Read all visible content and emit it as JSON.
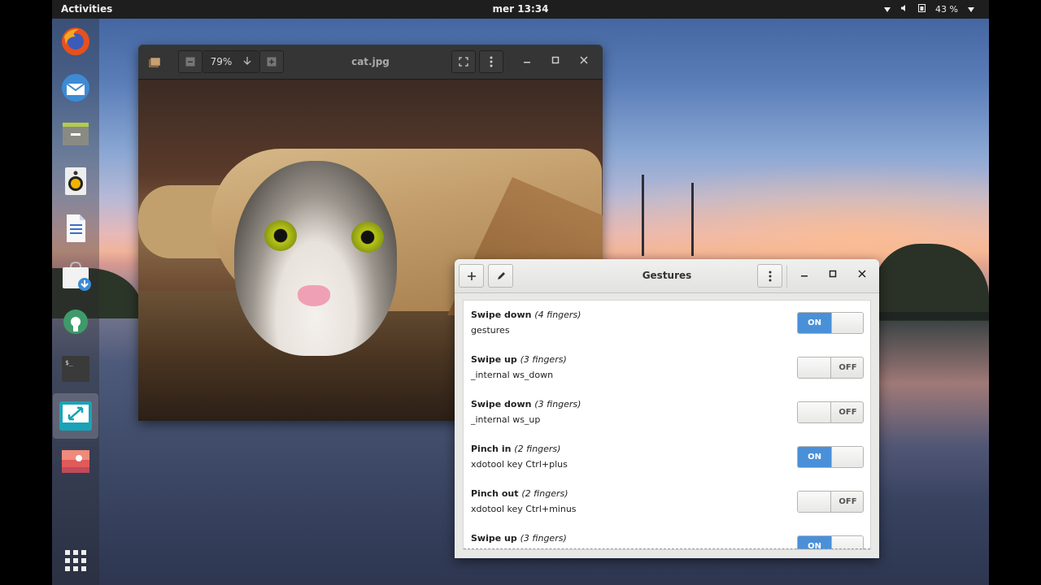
{
  "topbar": {
    "activities_label": "Activities",
    "clock": "mer 13:34",
    "battery_percent": "43 %"
  },
  "dock": {
    "items": [
      "firefox-icon",
      "thunderbird-icon",
      "files-icon",
      "rhythmbox-icon",
      "writer-icon",
      "software-icon",
      "settings-icon",
      "terminal-icon",
      "gestures-app-icon",
      "image-viewer-icon",
      "app-grid-icon"
    ],
    "terminal_glyph": "$_"
  },
  "viewer": {
    "title": "cat.jpg",
    "zoom": "79%",
    "zoom_out_label": "−",
    "zoom_in_label": "+"
  },
  "gestures": {
    "title": "Gestures",
    "add_label": "+",
    "rows": [
      {
        "action": "Swipe down",
        "fingers": "(4 fingers)",
        "command": "gestures",
        "state": "ON"
      },
      {
        "action": "Swipe up",
        "fingers": "(3 fingers)",
        "command": "_internal ws_down",
        "state": "OFF"
      },
      {
        "action": "Swipe down",
        "fingers": "(3 fingers)",
        "command": "_internal ws_up",
        "state": "OFF"
      },
      {
        "action": "Pinch in",
        "fingers": "(2 fingers)",
        "command": "xdotool key Ctrl+plus",
        "state": "ON"
      },
      {
        "action": "Pinch out",
        "fingers": "(2 fingers)",
        "command": "xdotool key Ctrl+minus",
        "state": "OFF"
      },
      {
        "action": "Swipe up",
        "fingers": "(3 fingers)",
        "command": "",
        "state": "ON"
      }
    ]
  },
  "colors": {
    "accent_on": "#4a90d9",
    "topbar_bg": "#1e1e1e"
  }
}
